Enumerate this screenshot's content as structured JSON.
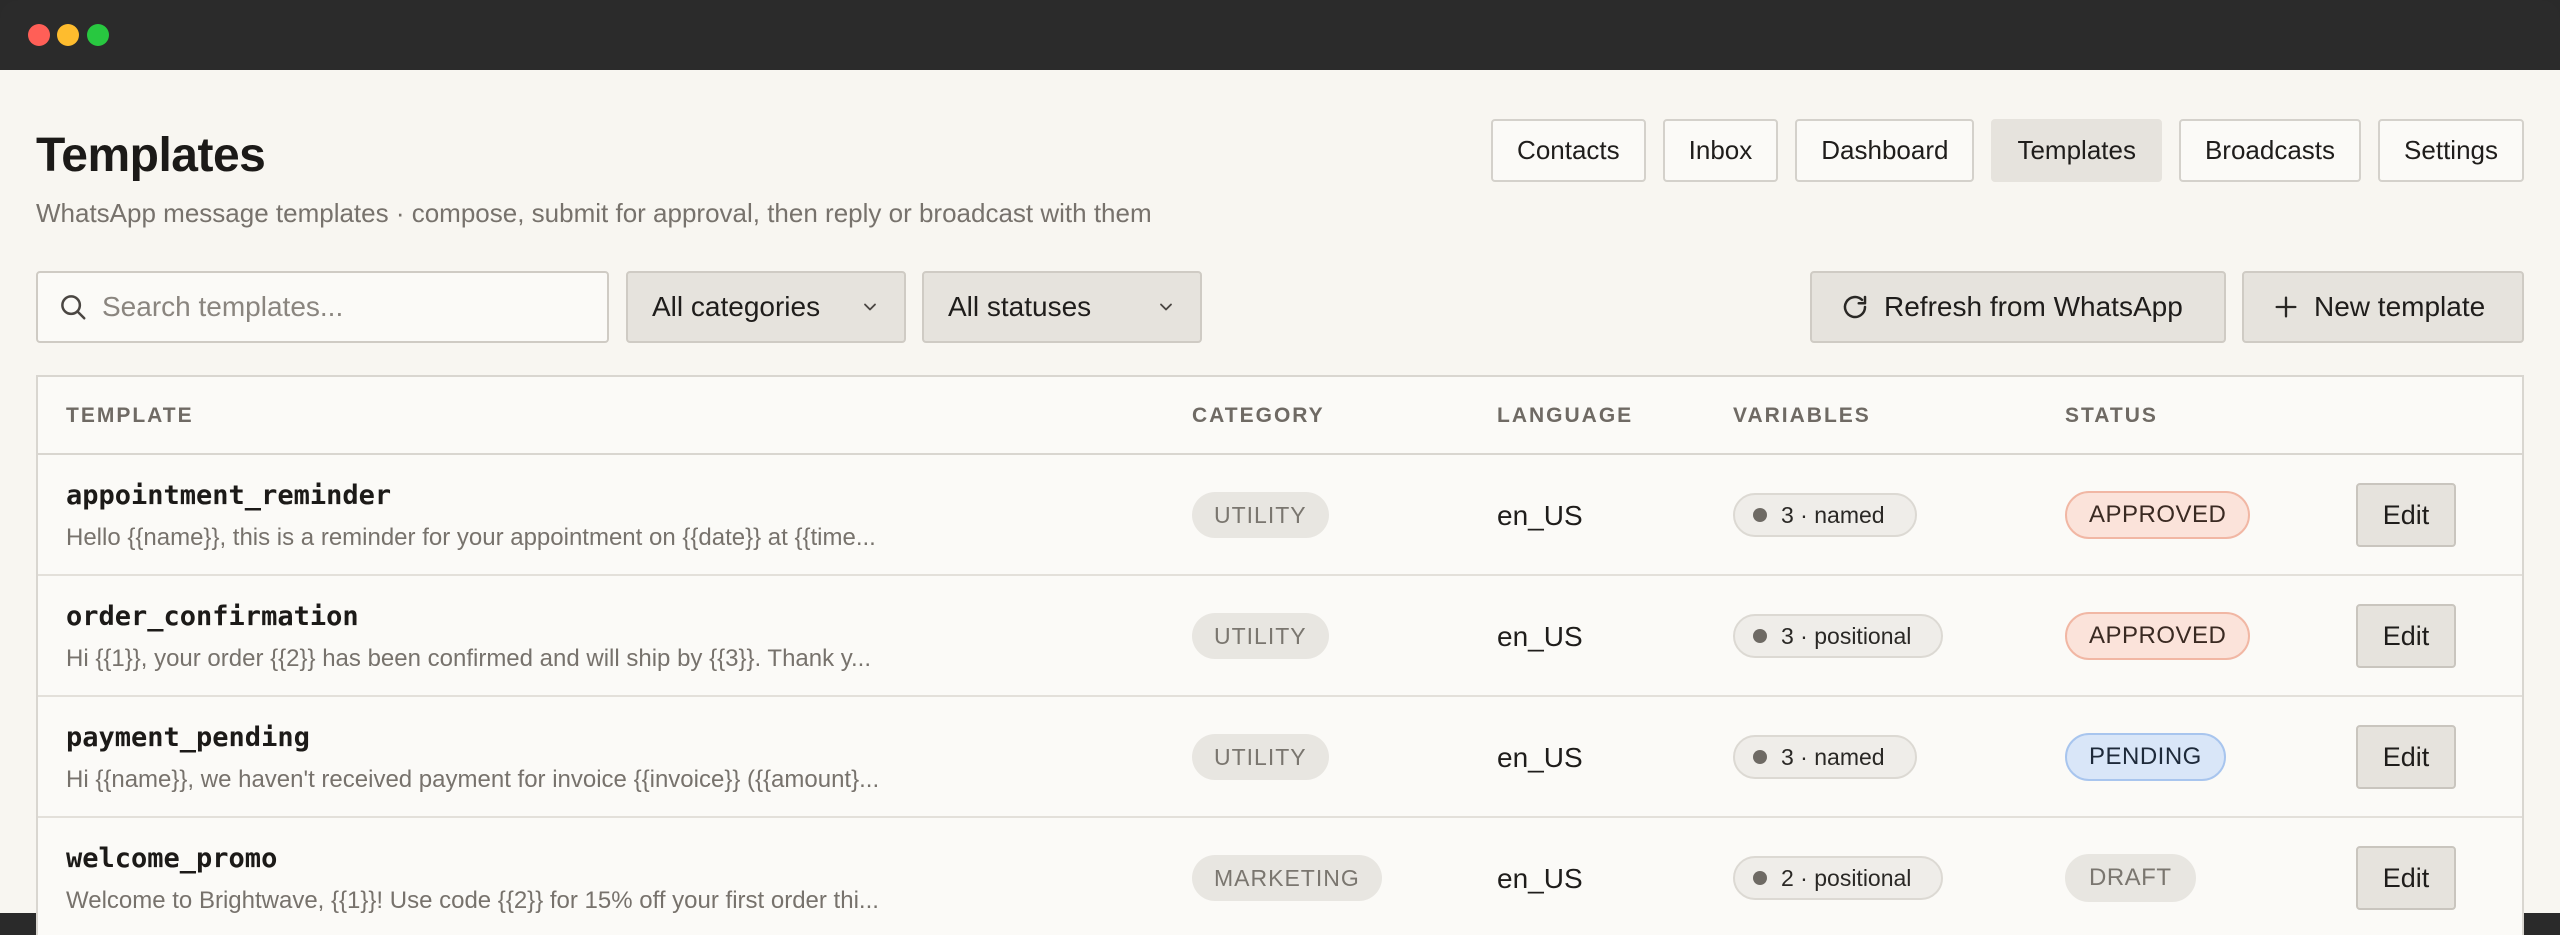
{
  "window": {
    "controls": [
      "close",
      "minimize",
      "zoom"
    ]
  },
  "header": {
    "title": "Templates",
    "subtitle": "WhatsApp message templates · compose, submit for approval, then reply or broadcast with them"
  },
  "nav": {
    "items": [
      {
        "label": "Contacts",
        "active": false
      },
      {
        "label": "Inbox",
        "active": false
      },
      {
        "label": "Dashboard",
        "active": false
      },
      {
        "label": "Templates",
        "active": true
      },
      {
        "label": "Broadcasts",
        "active": false
      },
      {
        "label": "Settings",
        "active": false
      }
    ]
  },
  "toolbar": {
    "search_placeholder": "Search templates...",
    "search_value": "",
    "category_filter": "All categories",
    "status_filter": "All statuses",
    "refresh_label": "Refresh from WhatsApp",
    "new_label": "New template"
  },
  "table": {
    "columns": [
      "TEMPLATE",
      "CATEGORY",
      "LANGUAGE",
      "VARIABLES",
      "STATUS"
    ],
    "rows": [
      {
        "name": "appointment_reminder",
        "body": "Hello {{name}}, this is a reminder for your appointment on {{date}} at {{time...",
        "category": "UTILITY",
        "language": "en_US",
        "variables": "3 · named",
        "status": "APPROVED",
        "action": "Edit"
      },
      {
        "name": "order_confirmation",
        "body": "Hi {{1}}, your order {{2}} has been confirmed and will ship by {{3}}. Thank y...",
        "category": "UTILITY",
        "language": "en_US",
        "variables": "3 · positional",
        "status": "APPROVED",
        "action": "Edit"
      },
      {
        "name": "payment_pending",
        "body": "Hi {{name}}, we haven't received payment for invoice {{invoice}} ({{amount}...",
        "category": "UTILITY",
        "language": "en_US",
        "variables": "3 · named",
        "status": "PENDING",
        "action": "Edit"
      },
      {
        "name": "welcome_promo",
        "body": "Welcome to Brightwave, {{1}}! Use code {{2}} for 15% off your first order thi...",
        "category": "MARKETING",
        "language": "en_US",
        "variables": "2 · positional",
        "status": "DRAFT",
        "action": "Edit"
      }
    ]
  },
  "colors": {
    "background": "#f8f6f1",
    "approved": "#fbe3da",
    "pending": "#d9e6f8",
    "draft": "#e8e6e1"
  }
}
